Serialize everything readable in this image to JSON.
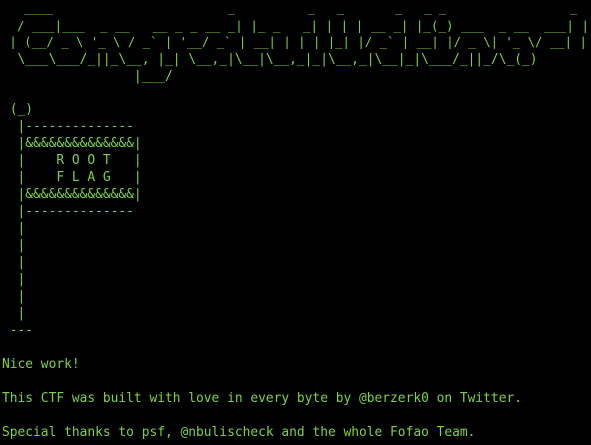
{
  "terminal": {
    "colors": {
      "background": "#000000",
      "foreground": "#7fd33a"
    },
    "banner": [
      "   ____                        _          _   _       _   _ _                 _ ",
      "  / ___|___  _ __   __ _ _ __ _| |_ _   _| | | | __ _| |_(_) ___  _ __  ___| |",
      " | (__/ _ \\ '_ \\ / _` | '__/ _` | __| | | | |_| |/ _` | __| |/ _ \\| '_ \\/ __| |",
      "  \\___\\___/_||_\\__, |_| \\__,_|\\__|\\__,_|_|\\__,_|\\__|_|\\___/_||_/\\_(_)",
      "                 |___/"
    ],
    "flag_art": [
      " (_)",
      "  |--------------",
      "  |&&&&&&&&&&&&&&|",
      "  |    R O O T   |",
      "  |    F L A G   |",
      "  |&&&&&&&&&&&&&&|",
      "  |--------------",
      "  |",
      "  |",
      "  |",
      "  |",
      "  |",
      "  |",
      " ---"
    ],
    "messages": [
      "Nice work!",
      "This CTF was built with love in every byte by @berzerk0 on Twitter.",
      "Special thanks to psf, @nbulischeck and the whole Fofao Team."
    ]
  }
}
